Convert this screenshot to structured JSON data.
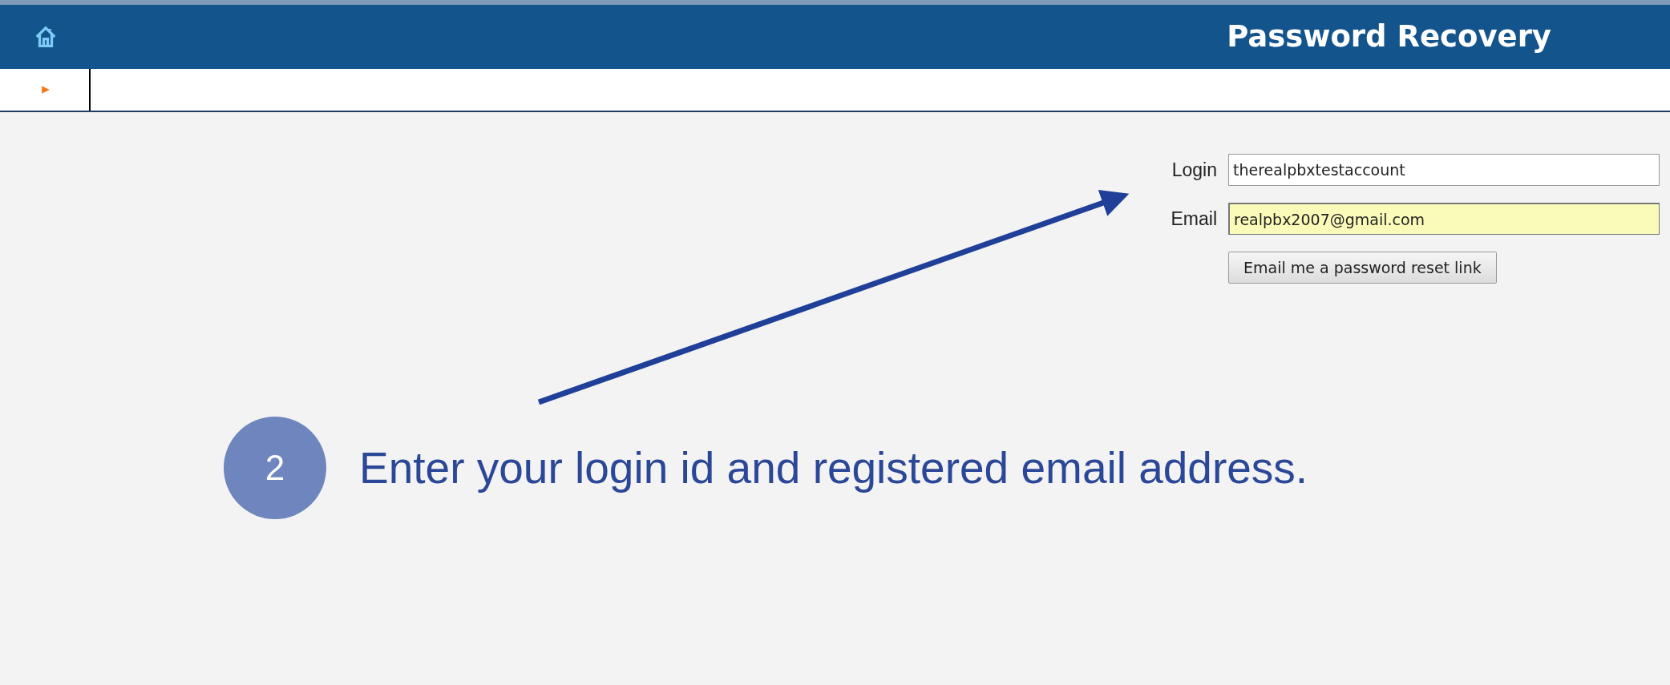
{
  "header": {
    "title": "Password Recovery"
  },
  "form": {
    "fields": [
      {
        "label": "Login",
        "value": "therealpbxtestaccount",
        "highlighted": false
      },
      {
        "label": "Email",
        "value": "realpbx2007@gmail.com",
        "highlighted": true
      }
    ],
    "button": "Email me a password reset link"
  },
  "callout": {
    "step": "2",
    "text": "Enter your login id and registered email address."
  }
}
